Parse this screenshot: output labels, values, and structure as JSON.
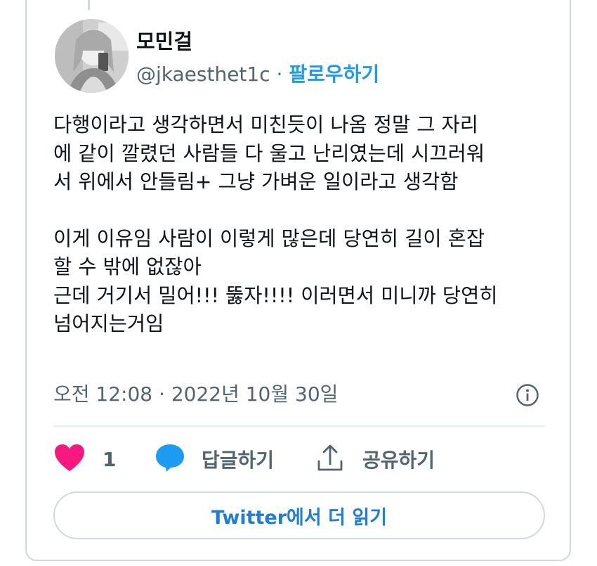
{
  "tweet": {
    "display_name": "모민걸",
    "handle": "@jkaesthet1c",
    "separator": " · ",
    "follow_label": "팔로우하기",
    "body_paragraph_1": [
      "다행이라고 생각하면서 미친듯이 나옴 정말 그 자리",
      "에 같이 깔렸던 사람들 다 울고 난리였는데 시끄러워",
      "서 위에서 안들림+ 그냥 가벼운 일이라고 생각함"
    ],
    "body_paragraph_2": [
      "이게 이유임 사람이 이렇게 많은데 당연히 길이 혼잡",
      "할 수 밖에 없잖아",
      "근데 거기서 밀어!!! 뚫자!!!! 이러면서 미니까 당연히",
      "넘어지는거임"
    ],
    "timestamp": "오전 12:08 · 2022년 10월 30일",
    "like_count": "1",
    "reply_label": "답글하기",
    "share_label": "공유하기",
    "read_more_label": "Twitter에서 더 읽기"
  },
  "icons": {
    "like": "heart-icon",
    "reply": "speech-bubble-icon",
    "share": "share-icon",
    "info": "info-icon"
  },
  "colors": {
    "like": "#f91880",
    "reply": "#1d9bf0",
    "follow": "#1d9bf0",
    "read_more": "#1d7ed6",
    "secondary_text": "#536471"
  }
}
